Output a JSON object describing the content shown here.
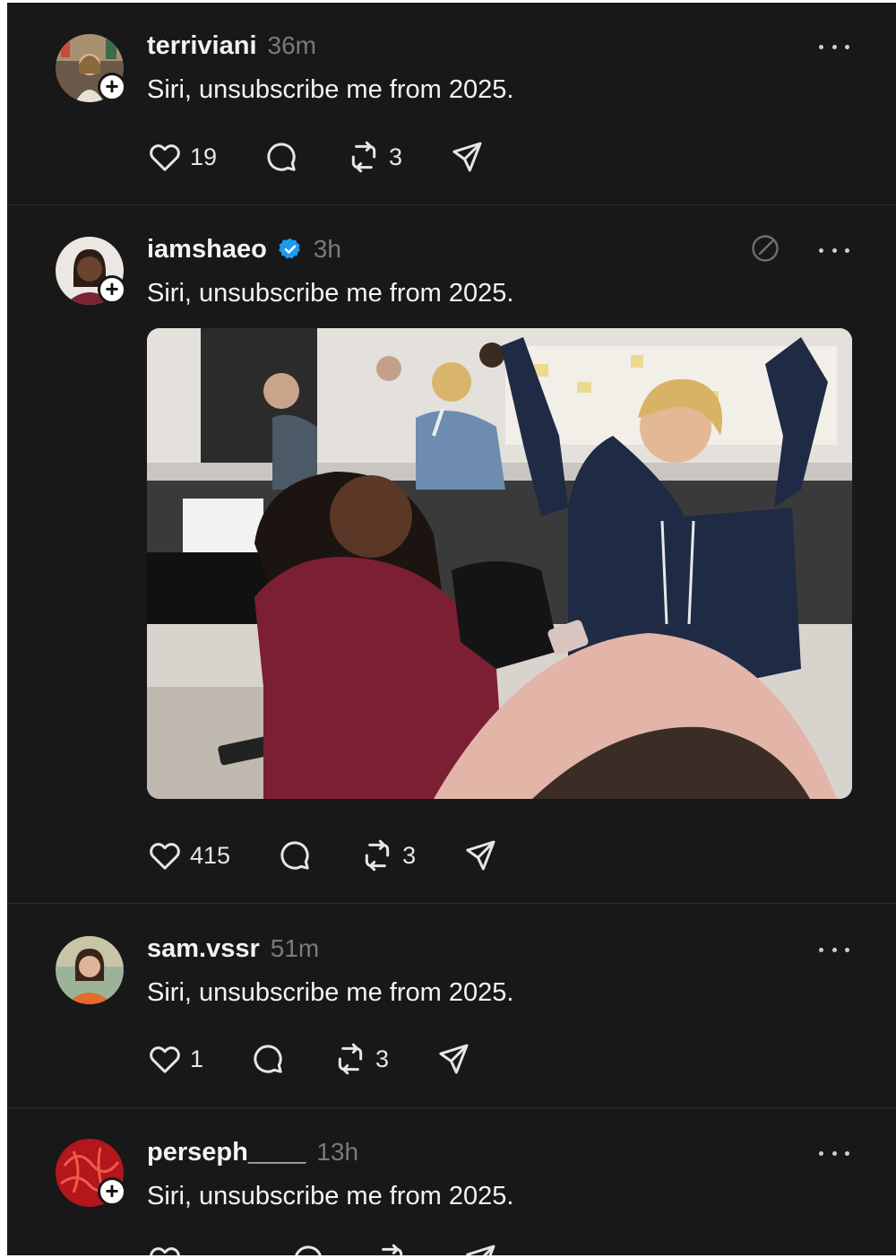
{
  "posts": [
    {
      "username": "terriviani",
      "time": "36m",
      "text": "Siri, unsubscribe me from 2025.",
      "likes": "19",
      "reposts": "3",
      "has_follow_badge": true
    },
    {
      "username": "iamshaeo",
      "time": "3h",
      "verified": true,
      "text": "Siri, unsubscribe me from 2025.",
      "likes": "415",
      "reposts": "3",
      "has_follow_badge": true,
      "has_image": true
    },
    {
      "username": "sam.vssr",
      "time": "51m",
      "text": "Siri, unsubscribe me from 2025.",
      "likes": "1",
      "reposts": "3",
      "has_follow_badge": false
    },
    {
      "username": "perseph____",
      "time": "13h",
      "text": "Siri, unsubscribe me from 2025.",
      "has_follow_badge": true
    }
  ],
  "icons": {
    "like": "heart-icon",
    "reply": "comment-icon",
    "repost": "repost-icon",
    "share": "send-icon",
    "more": "more-options-icon",
    "mute": "mute-icon",
    "verified": "verified-badge-icon",
    "follow": "plus-icon"
  },
  "colors": {
    "background": "#181818",
    "text": "#f3f3f3",
    "muted": "#7a7a7a",
    "verified": "#1d9bf0"
  }
}
